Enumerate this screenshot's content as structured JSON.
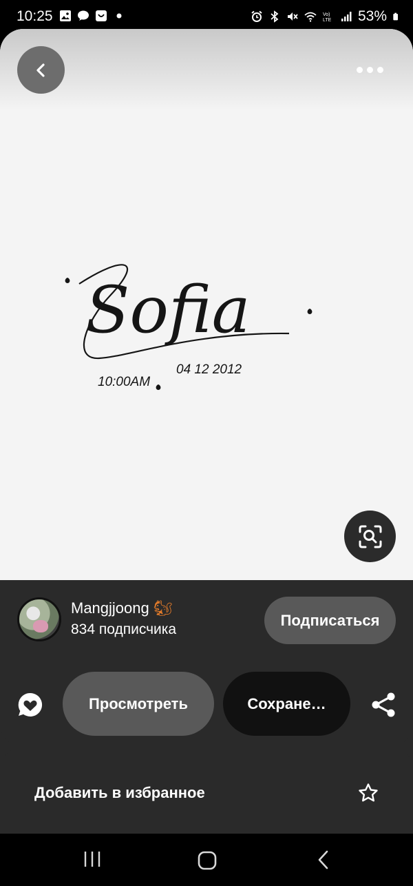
{
  "status_bar": {
    "time": "10:25",
    "battery": "53%",
    "left_icons": [
      "gallery-icon",
      "message-icon",
      "shopping-icon",
      "dot-icon"
    ],
    "right_icons": [
      "alarm-icon",
      "bluetooth-icon",
      "mute-icon",
      "wifi-icon",
      "volte-icon",
      "signal-icon",
      "battery-icon"
    ]
  },
  "top_bar": {
    "back_icon": "chevron-left-icon",
    "more_icon": "more-icon"
  },
  "artwork": {
    "name": "Sofia",
    "time": "10:00AM",
    "date": "04 12 2012"
  },
  "pin": {
    "author_name": "Mangjjoong",
    "author_emoji": "🐿",
    "followers": "834 подписчика",
    "subscribe_label": "Подписаться",
    "view_label": "Просмотреть",
    "save_label": "Сохране…"
  },
  "favorite": {
    "label": "Добавить в избранное",
    "icon": "star-icon"
  },
  "colors": {
    "surface": "#2a2a2a",
    "button_gray": "#595959",
    "button_dark": "#111111",
    "image_bg": "#f4f4f4"
  }
}
